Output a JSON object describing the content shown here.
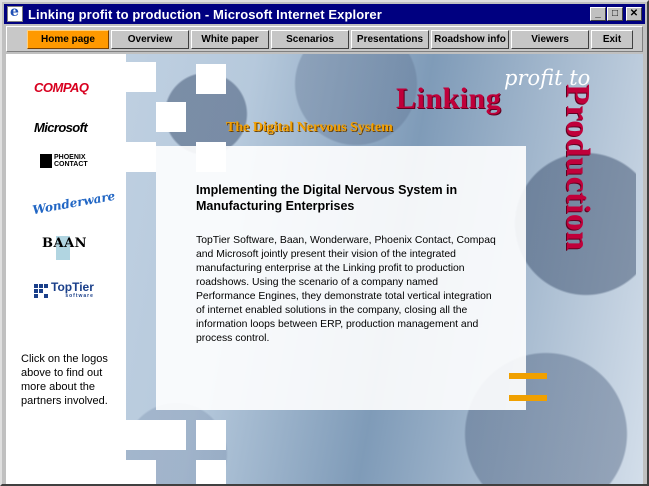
{
  "window": {
    "title": "Linking profit to production - Microsoft Internet Explorer",
    "controls": {
      "minimize": "_",
      "maximize": "□",
      "close": "✕"
    }
  },
  "nav": {
    "items": [
      {
        "label": "Home page",
        "active": true
      },
      {
        "label": "Overview"
      },
      {
        "label": "White paper"
      },
      {
        "label": "Scenarios"
      },
      {
        "label": "Presentations"
      },
      {
        "label": "Roadshow info"
      },
      {
        "label": "Viewers"
      },
      {
        "label": "Exit"
      }
    ]
  },
  "header": {
    "profit_to": "profit to",
    "linking": "Linking",
    "production": "Production",
    "tagline": "The Digital Nervous System"
  },
  "sidebar": {
    "logos": {
      "compaq": "COMPAQ",
      "microsoft": "Microsoft",
      "phoenix_line1": "PHOENIX",
      "phoenix_line2": "CONTACT",
      "wonderware": "Wonderware",
      "baan": "BAAN",
      "toptier": "TopTier",
      "toptier_sub": "software"
    },
    "note": "Click on the logos above to find out more about the partners involved."
  },
  "main": {
    "heading": "Implementing the Digital Nervous System in Manufacturing Enterprises",
    "body": "TopTier Software, Baan, Wonderware, Phoenix Contact, Compaq and Microsoft jointly present their vision of the integrated manufacturing enterprise at the Linking profit to production roadshows. Using the scenario of a company named Performance Engines, they demonstrate total vertical integration of internet enabled solutions in the company, closing all the information loops between ERP, production management and process control."
  },
  "colors": {
    "titlebar": "#000080",
    "nav_active": "#ff9900",
    "brand_red": "#c0003a",
    "accent_orange": "#f4a000"
  }
}
